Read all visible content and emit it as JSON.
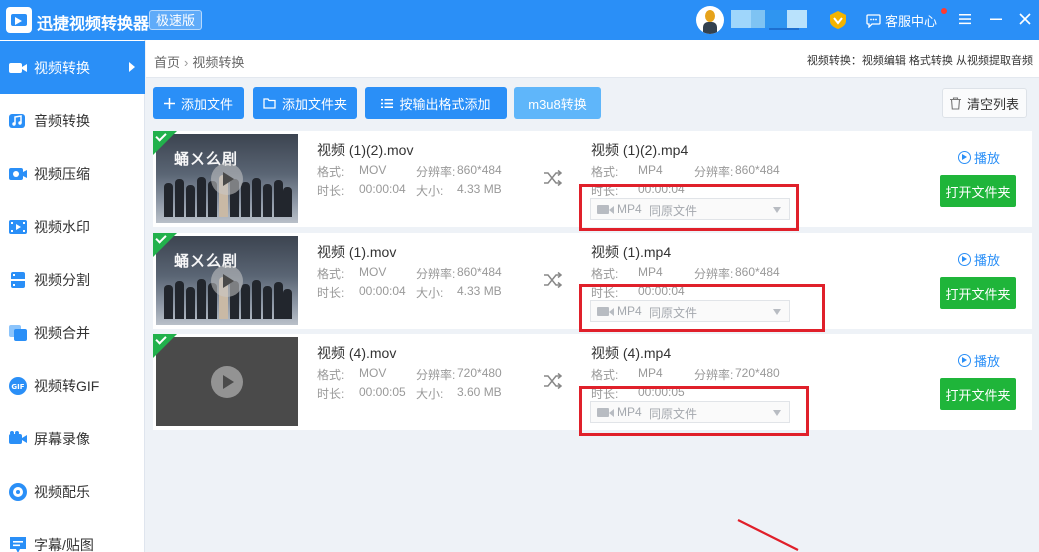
{
  "app": {
    "title": "迅捷视频转换器",
    "edition": "极速版",
    "service_label": "客服中心",
    "accent": "#2a8ff7",
    "open_button_color": "#1fb53a",
    "highlight_color": "#e0202a"
  },
  "sidebar": {
    "items": [
      {
        "label": "视频转换",
        "icon": "video-convert-icon",
        "active": true
      },
      {
        "label": "音频转换",
        "icon": "audio-convert-icon",
        "active": false
      },
      {
        "label": "视频压缩",
        "icon": "video-compress-icon",
        "active": false
      },
      {
        "label": "视频水印",
        "icon": "video-watermark-icon",
        "active": false
      },
      {
        "label": "视频分割",
        "icon": "video-split-icon",
        "active": false
      },
      {
        "label": "视频合并",
        "icon": "video-merge-icon",
        "active": false
      },
      {
        "label": "视频转GIF",
        "icon": "gif-icon",
        "active": false
      },
      {
        "label": "屏幕录像",
        "icon": "screen-record-icon",
        "active": false
      },
      {
        "label": "视频配乐",
        "icon": "music-icon",
        "active": false
      },
      {
        "label": "字幕/贴图",
        "icon": "subtitle-icon",
        "active": false
      }
    ]
  },
  "breadcrumb": {
    "home": "首页",
    "current": "视频转换",
    "separator": "›"
  },
  "feature_links": "视频转换：视频编辑 格式转换 从视频提取音频",
  "toolbar": {
    "add_file": "添加文件",
    "add_folder": "添加文件夹",
    "add_by_format": "按输出格式添加",
    "m3u8": "m3u8转换",
    "clear_list": "清空列表"
  },
  "labels": {
    "format": "格式:",
    "resolution": "分辨率:",
    "duration": "时长:",
    "size": "大小:",
    "play": "播放",
    "open_folder": "打开文件夹"
  },
  "files": [
    {
      "src_name": "视频 (1)(2).mov",
      "src_format": "MOV",
      "src_resolution": "860*484",
      "src_duration": "00:00:04",
      "src_size": "4.33 MB",
      "out_name": "视频 (1)(2).mp4",
      "out_format": "MP4",
      "out_resolution": "860*484",
      "out_duration": "00:00:04",
      "select_format": "MP4",
      "select_quality": "同原文件",
      "thumb": "poster",
      "poster_text": "蛹ㄨ么剧"
    },
    {
      "src_name": "视频 (1).mov",
      "src_format": "MOV",
      "src_resolution": "860*484",
      "src_duration": "00:00:04",
      "src_size": "4.33 MB",
      "out_name": "视频 (1).mp4",
      "out_format": "MP4",
      "out_resolution": "860*484",
      "out_duration": "00:00:04",
      "select_format": "MP4",
      "select_quality": "同原文件",
      "thumb": "poster",
      "poster_text": "蛹ㄨ么剧"
    },
    {
      "src_name": "视频 (4).mov",
      "src_format": "MOV",
      "src_resolution": "720*480",
      "src_duration": "00:00:05",
      "src_size": "3.60 MB",
      "out_name": "视频 (4).mp4",
      "out_format": "MP4",
      "out_resolution": "720*480",
      "out_duration": "00:00:05",
      "select_format": "MP4",
      "select_quality": "同原文件",
      "thumb": "dark"
    }
  ]
}
